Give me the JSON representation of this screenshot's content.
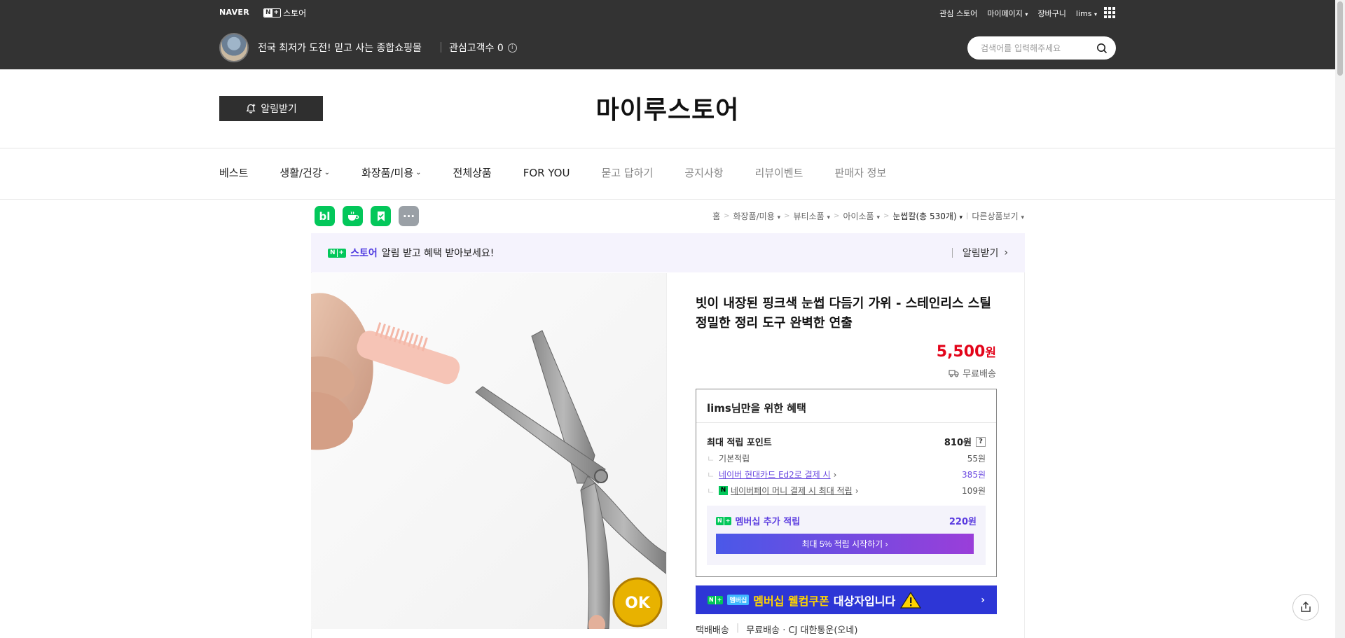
{
  "topbar": {
    "naver": "NAVER",
    "nstore_n": "N",
    "nstore_plus": "+",
    "nstore": "스토어",
    "links": [
      "관심 스토어",
      "마이페이지",
      "장바구니",
      "lims"
    ],
    "store_desc": "전국 최저가 도전! 믿고 사는 종합쇼핑몰",
    "fav_label": "관심고객수 0",
    "search_placeholder": "검색어를 입력해주세요"
  },
  "header": {
    "alarm_label": "알림받기",
    "store_title": "마이루스토어"
  },
  "nav": {
    "items": [
      {
        "label": "베스트",
        "dropdown": false,
        "muted": false
      },
      {
        "label": "생활/건강",
        "dropdown": true,
        "muted": false
      },
      {
        "label": "화장품/미용",
        "dropdown": true,
        "muted": false
      },
      {
        "label": "전체상품",
        "dropdown": false,
        "muted": false
      },
      {
        "label": "FOR YOU",
        "dropdown": false,
        "muted": false
      },
      {
        "label": "묻고 답하기",
        "dropdown": false,
        "muted": true
      },
      {
        "label": "공지사항",
        "dropdown": false,
        "muted": true
      },
      {
        "label": "리뷰이벤트",
        "dropdown": false,
        "muted": true
      },
      {
        "label": "판매자 정보",
        "dropdown": false,
        "muted": true
      }
    ]
  },
  "share_icons": {
    "blog": "bl",
    "more": "···",
    "colors": {
      "green": "#03c75a",
      "gray": "#9aa0a6"
    }
  },
  "breadcrumb": {
    "items": [
      "홈",
      "화장품/미용",
      "뷰티소품",
      "아이소품",
      "눈썹칼(총 530개)",
      "다른상품보기"
    ]
  },
  "promo": {
    "store_label": "스토어",
    "text": "알림 받고 혜택 받아보세요!",
    "action": "알림받기"
  },
  "product": {
    "title": "빗이 내장된 핑크색 눈썹 다듬기 가위 - 스테인리스 스틸 정밀한 정리 도구 완벽한 연출",
    "price": "5,500",
    "price_unit": "원",
    "shipping": "무료배송",
    "price_color": "#e3041a",
    "seal_text": "OK"
  },
  "benefit": {
    "user": "lims",
    "title_suffix": "님만을 위한 혜택",
    "max_points_label": "최대 적립 포인트",
    "max_points": "810원",
    "help": "?",
    "rows": [
      {
        "label": "기본적립",
        "value": "55원"
      },
      {
        "label": "네이버 현대카드 Ed2로 결제 시",
        "value": "385원"
      },
      {
        "label": "네이버페이 머니 결제 시 최대 적립",
        "value": "109원"
      }
    ],
    "membership_label": "멤버십 추가 적립",
    "membership_value": "220원",
    "membership_button": "최대 5% 적립 시작하기"
  },
  "welcome": {
    "badge": "멤버십",
    "highlight": "멤버십 웰컴쿠폰",
    "text": "대상자입니다"
  },
  "delivery": {
    "type": "택배배송",
    "info": "무료배송 · CJ 대한통운(오네)"
  }
}
